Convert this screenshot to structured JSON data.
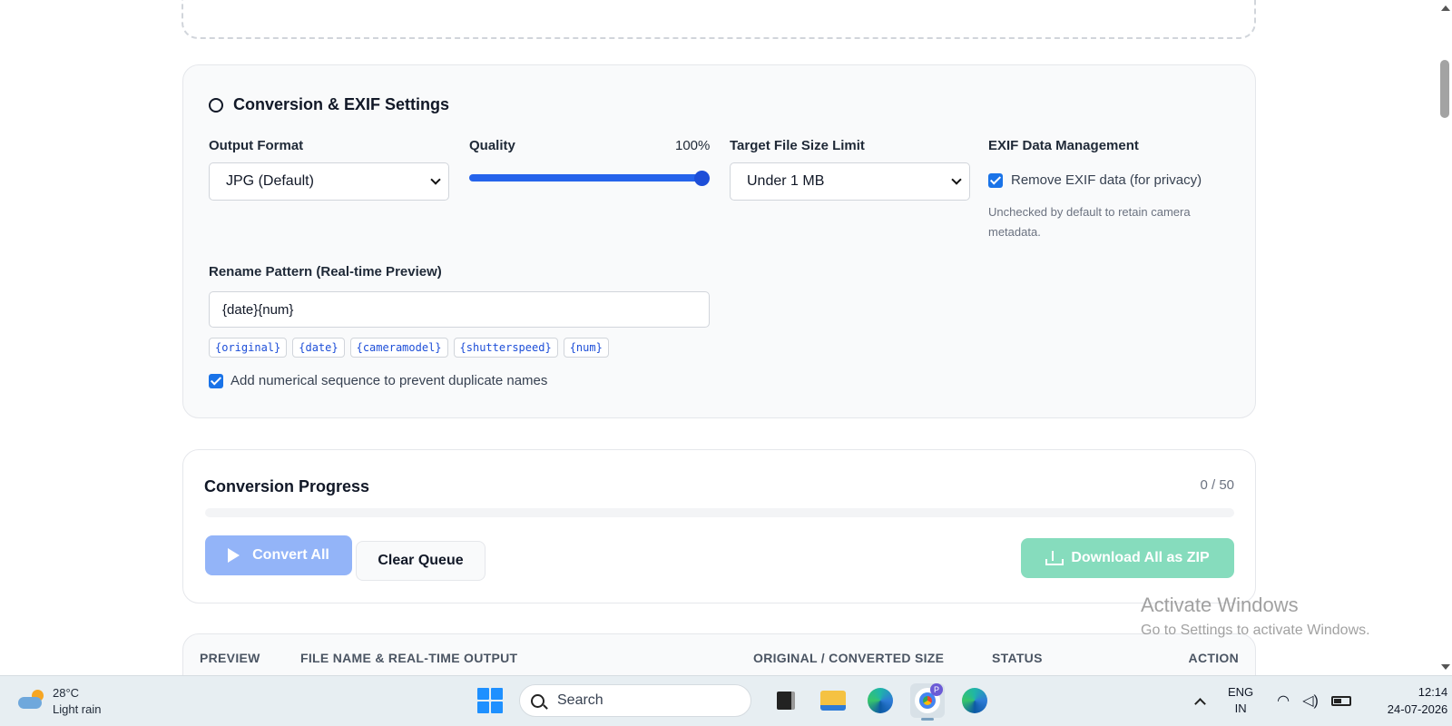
{
  "settings": {
    "title": "Conversion & EXIF Settings",
    "output_format": {
      "label": "Output Format",
      "value": "JPG (Default)"
    },
    "quality": {
      "label": "Quality",
      "value_text": "100%",
      "value": 100
    },
    "target_size": {
      "label": "Target File Size Limit",
      "value": "Under 1 MB"
    },
    "exif": {
      "label": "EXIF Data Management",
      "checkbox_label": "Remove EXIF data (for privacy)",
      "checked": true,
      "hint": "Unchecked by default to retain camera metadata."
    },
    "rename": {
      "label": "Rename Pattern (Real-time Preview)",
      "value": "{date}{num}",
      "tokens": [
        "{original}",
        "{date}",
        "{cameramodel}",
        "{shutterspeed}",
        "{num}"
      ],
      "sequence_label": "Add numerical sequence to prevent duplicate names",
      "sequence_checked": true
    }
  },
  "progress": {
    "title": "Conversion Progress",
    "count": "0 / 50",
    "fraction": 0,
    "convert_label": "Convert All",
    "clear_label": "Clear Queue",
    "zip_label": "Download All as ZIP"
  },
  "table": {
    "headers": [
      "PREVIEW",
      "FILE NAME & REAL-TIME OUTPUT",
      "ORIGINAL / CONVERTED SIZE",
      "STATUS",
      "ACTION"
    ]
  },
  "watermark": {
    "line1": "Activate Windows",
    "line2": "Go to Settings to activate Windows."
  },
  "taskbar": {
    "weather_temp": "28°C",
    "weather_desc": "Light rain",
    "search_placeholder": "Search",
    "chrome_badge": "P",
    "lang_line1": "ENG",
    "lang_line2": "IN",
    "time": "12:14",
    "date": "24-07-2026"
  },
  "colors": {
    "accent": "#2563eb",
    "convert_disabled": "#93b4f8",
    "zip_disabled": "#86dcbd",
    "card_bg": "#f9fafb"
  }
}
